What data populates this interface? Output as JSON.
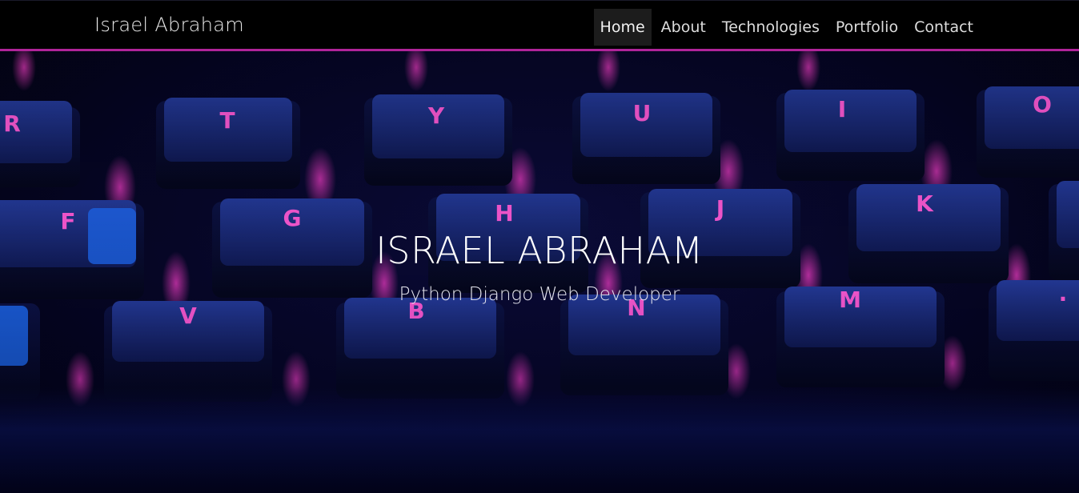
{
  "navbar": {
    "brand": "Israel Abraham",
    "links": [
      {
        "label": "Home",
        "active": true
      },
      {
        "label": "About",
        "active": false
      },
      {
        "label": "Technologies",
        "active": false
      },
      {
        "label": "Portfolio",
        "active": false
      },
      {
        "label": "Contact",
        "active": false
      }
    ],
    "accent_color": "#b0249a"
  },
  "hero": {
    "title": "ISRAEL ABRAHAM",
    "subtitle": "Python Django Web Developer",
    "background_image": "keyboard-photo",
    "key_glow_color": "#ff3fd0",
    "key_color": "#1a2a7a"
  }
}
